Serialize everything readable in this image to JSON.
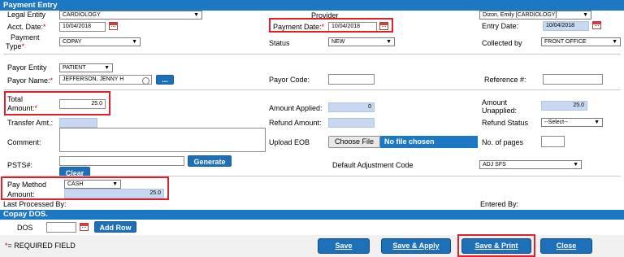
{
  "sections": {
    "payment_entry": "Payment Entry",
    "copay_dos": "Copay DOS."
  },
  "fields": {
    "legal_entity": {
      "label": "Legal Entity",
      "value": "CARDIOLOGY"
    },
    "provider": {
      "label": "Provider",
      "value": "Dizon, Emily [CARDIOLOGY]"
    },
    "acct_date": {
      "label": "Acct. Date:",
      "value": "10/04/2018"
    },
    "payment_date": {
      "label": "Payment Date:",
      "value": "10/04/2018"
    },
    "entry_date": {
      "label": "Entry Date:",
      "value": "10/04/2018"
    },
    "payment_type": {
      "label_line1": "Payment",
      "label_line2": "Type",
      "value": "COPAY"
    },
    "status": {
      "label": "Status",
      "value": "NEW"
    },
    "collected_by": {
      "label": "Collected by",
      "value": "FRONT OFFICE"
    },
    "payor_entity": {
      "label": "Payor Entity",
      "value": "PATIENT"
    },
    "payor_name": {
      "label": "Payor Name:",
      "value": "JEFFERSON, JENNY H",
      "button": "..."
    },
    "payor_code": {
      "label": "Payor Code:",
      "value": ""
    },
    "reference": {
      "label": "Reference #:",
      "value": ""
    },
    "total_amount": {
      "label_line1": "Total",
      "label_line2": "Amount:",
      "value": "25.0"
    },
    "amount_applied": {
      "label": "Amount Applied:",
      "value": "0"
    },
    "amount_unapplied": {
      "label_line1": "Amount",
      "label_line2": "Unapplied:",
      "value": "25.0"
    },
    "transfer_amt": {
      "label": "Transfer Amt.:",
      "value": ""
    },
    "refund_amount": {
      "label": "Refund Amount:",
      "value": ""
    },
    "refund_status": {
      "label": "Refund Status",
      "value": "--Select--"
    },
    "comment": {
      "label": "Comment:",
      "value": ""
    },
    "upload_eob": {
      "label": "Upload EOB",
      "choose": "Choose File",
      "no_file": "No file chosen"
    },
    "no_of_pages": {
      "label": "No. of pages",
      "value": ""
    },
    "psts": {
      "label": "PSTS#:",
      "value": "",
      "generate": "Generate",
      "clear": "Clear"
    },
    "default_adjustment_code": {
      "label": "Default Adjustment Code",
      "value": "ADJ SFS"
    },
    "pay_method": {
      "label": "Pay Method",
      "value": "CASH"
    },
    "pm_amount": {
      "label": "Amount:",
      "value": "25.0"
    },
    "last_processed_by": {
      "label": "Last Processed By:",
      "value": ""
    },
    "entered_by": {
      "label": "Entered By:",
      "value": ""
    },
    "dos": {
      "label": "DOS",
      "value": "",
      "add_row": "Add Row"
    }
  },
  "required_marker": "*",
  "required_note": "= REQUIRED FIELD",
  "buttons": {
    "save": "Save",
    "save_apply": "Save & Apply",
    "save_print": "Save & Print",
    "close": "Close"
  },
  "icons": {
    "calendar": "calendar-icon",
    "dropdown": "chevron-down-icon",
    "search": "search-icon"
  },
  "colors": {
    "header_blue": "#1d78c4",
    "button_blue": "#1d6fb8",
    "readonly_fill": "#c8d8f0",
    "highlight_red": "#e0202a",
    "required_red": "#d40000"
  }
}
